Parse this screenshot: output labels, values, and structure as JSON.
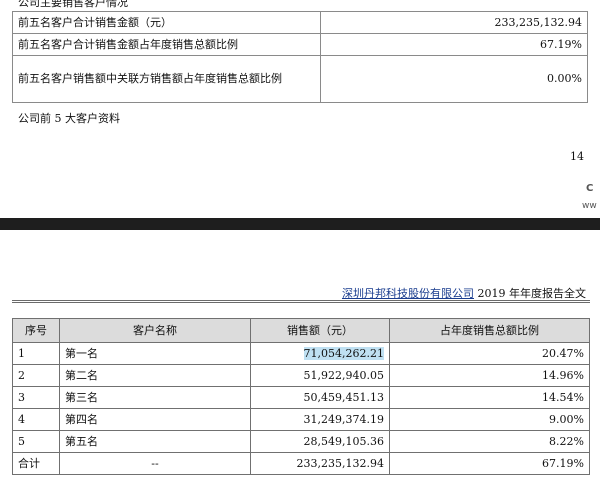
{
  "top_section": {
    "title": "公司主要销售客户情况",
    "rows": [
      {
        "label": "前五名客户合计销售金额（元）",
        "value": "233,235,132.94"
      },
      {
        "label": "前五名客户合计销售金额占年度销售总额比例",
        "value": "67.19%"
      },
      {
        "label": "前五名客户销售额中关联方销售额占年度销售总额比例",
        "value": "0.00%"
      }
    ],
    "subtitle": "公司前 5 大客户资料",
    "page_number": "14"
  },
  "watermark": {
    "line1": "C",
    "line2": "ww"
  },
  "page_header": {
    "company": "深圳丹邦科技股份有限公司",
    "report": " 2019 年年度报告全文"
  },
  "customer_table": {
    "headers": [
      "序号",
      "客户名称",
      "销售额（元）",
      "占年度销售总额比例"
    ],
    "rows": [
      {
        "no": "1",
        "name": "第一名",
        "amount": "71,054,262.21",
        "ratio": "20.47%"
      },
      {
        "no": "2",
        "name": "第二名",
        "amount": "51,922,940.05",
        "ratio": "14.96%"
      },
      {
        "no": "3",
        "name": "第三名",
        "amount": "50,459,451.13",
        "ratio": "14.54%"
      },
      {
        "no": "4",
        "name": "第四名",
        "amount": "31,249,374.19",
        "ratio": "9.00%"
      },
      {
        "no": "5",
        "name": "第五名",
        "amount": "28,549,105.36",
        "ratio": "8.22%"
      }
    ],
    "total": {
      "no": "合计",
      "name": "--",
      "amount": "233,235,132.94",
      "ratio": "67.19%"
    }
  }
}
